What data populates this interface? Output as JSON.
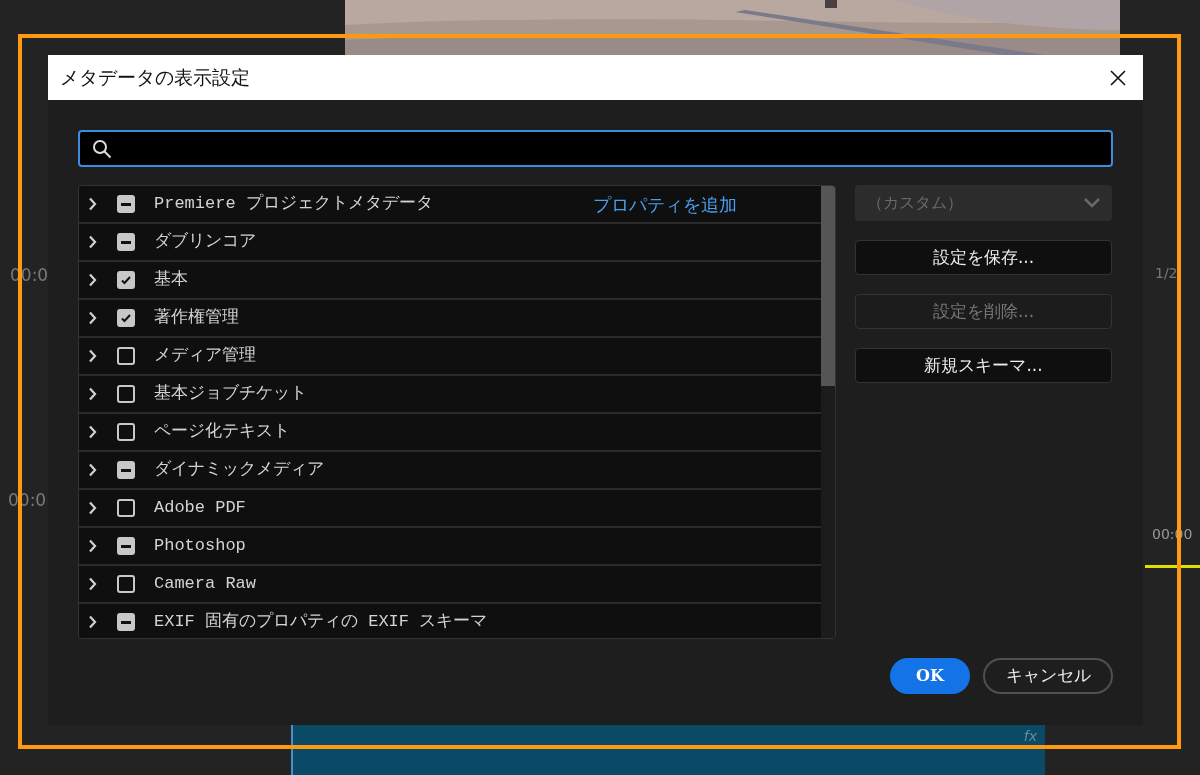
{
  "background": {
    "timecodes": [
      "00:0",
      "00:0"
    ],
    "page": "1/2",
    "ruler_time": "00:00",
    "clip": {
      "effect": "fx"
    }
  },
  "dialog": {
    "title": "メタデータの表示設定",
    "schemas": [
      {
        "label": "Premiere プロジェクトメタデータ",
        "checked": false,
        "indeterminate": true,
        "expanded": false,
        "link": "プロパティを追加"
      },
      {
        "label": "ダブリンコア",
        "checked": false,
        "indeterminate": true,
        "expanded": false
      },
      {
        "label": "基本",
        "checked": true,
        "indeterminate": false,
        "expanded": false
      },
      {
        "label": "著作権管理",
        "checked": true,
        "indeterminate": false,
        "expanded": false
      },
      {
        "label": "メディア管理",
        "checked": false,
        "indeterminate": false,
        "expanded": false
      },
      {
        "label": "基本ジョブチケット",
        "checked": false,
        "indeterminate": false,
        "expanded": false
      },
      {
        "label": "ページ化テキスト",
        "checked": false,
        "indeterminate": false,
        "expanded": false
      },
      {
        "label": "ダイナミックメディア",
        "checked": false,
        "indeterminate": true,
        "expanded": false
      },
      {
        "label": "Adobe PDF",
        "checked": false,
        "indeterminate": false,
        "expanded": false
      },
      {
        "label": "Photoshop",
        "checked": false,
        "indeterminate": true,
        "expanded": false
      },
      {
        "label": "Camera Raw",
        "checked": false,
        "indeterminate": false,
        "expanded": false
      },
      {
        "label": "EXIF 固有のプロパティの EXIF スキーマ",
        "checked": false,
        "indeterminate": true,
        "expanded": false
      }
    ],
    "preset": {
      "value": "（カスタム）",
      "disabled": true
    },
    "actions": [
      {
        "label": "設定を保存...",
        "disabled": false
      },
      {
        "label": "設定を削除...",
        "disabled": true
      },
      {
        "label": "新規スキーマ...",
        "disabled": false
      }
    ],
    "ok": "OK",
    "cancel": "キャンセル"
  }
}
